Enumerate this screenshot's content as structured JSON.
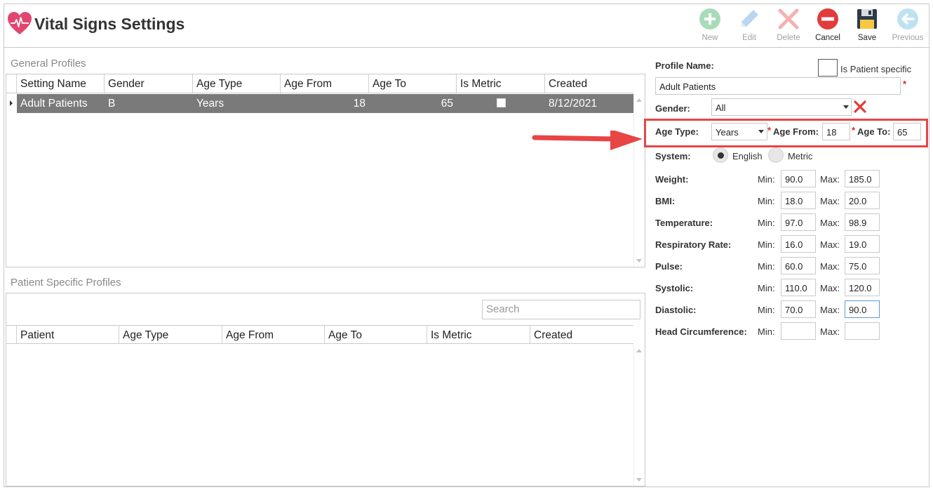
{
  "app": {
    "title": "Vital Signs Settings"
  },
  "toolbar": {
    "new_label": "New",
    "edit_label": "Edit",
    "delete_label": "Delete",
    "cancel_label": "Cancel",
    "save_label": "Save",
    "previous_label": "Previous"
  },
  "general_profiles": {
    "label": "General Profiles",
    "columns": [
      "Setting Name",
      "Gender",
      "Age Type",
      "Age From",
      "Age To",
      "Is Metric",
      "Created"
    ],
    "rows": [
      {
        "setting_name": "Adult Patients",
        "gender": "B",
        "age_type": "Years",
        "age_from": "18",
        "age_to": "65",
        "is_metric": false,
        "created": "8/12/2021"
      }
    ]
  },
  "patient_profiles": {
    "label": "Patient Specific Profiles",
    "search_placeholder": "Search",
    "columns": [
      "Patient",
      "Age Type",
      "Age From",
      "Age To",
      "Is Metric",
      "Created"
    ]
  },
  "form": {
    "profile_name_label": "Profile Name:",
    "profile_name_value": "Adult Patients",
    "is_patient_specific_label": "Is Patient specific",
    "gender_label": "Gender:",
    "gender_value": "All",
    "age_type_label": "Age Type:",
    "age_type_value": "Years",
    "age_from_label": "Age From:",
    "age_from_value": "18",
    "age_to_label": "Age To:",
    "age_to_value": "65",
    "required_mark": "*",
    "system_label": "System:",
    "system_options": [
      "English",
      "Metric"
    ],
    "system_selected": "English",
    "min_label": "Min:",
    "max_label": "Max:",
    "vitals": [
      {
        "label": "Weight:",
        "min": "90.0",
        "max": "185.0"
      },
      {
        "label": "BMI:",
        "min": "18.0",
        "max": "20.0"
      },
      {
        "label": "Temperature:",
        "min": "97.0",
        "max": "98.9"
      },
      {
        "label": "Respiratory Rate:",
        "min": "16.0",
        "max": "19.0"
      },
      {
        "label": "Pulse:",
        "min": "60.0",
        "max": "75.0"
      },
      {
        "label": "Systolic:",
        "min": "110.0",
        "max": "120.0"
      },
      {
        "label": "Diastolic:",
        "min": "70.0",
        "max": "90.0"
      },
      {
        "label": "Head Circumference:",
        "min": "",
        "max": ""
      }
    ]
  },
  "colors": {
    "selected_row": "#7a7a7a",
    "highlight": "#e84545",
    "required": "#e02424"
  }
}
